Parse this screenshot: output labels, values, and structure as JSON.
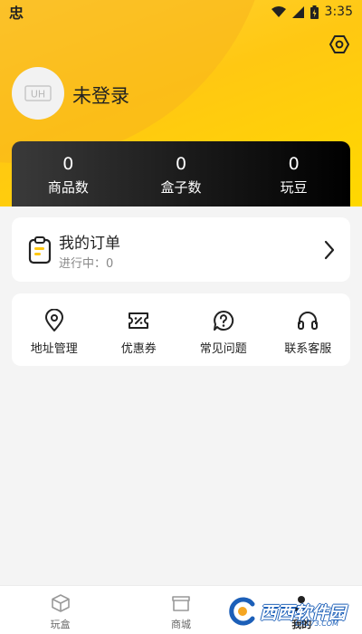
{
  "status_bar": {
    "app_glyph": "忠",
    "time": "3:35"
  },
  "profile": {
    "avatar_text": "UH",
    "name": "未登录"
  },
  "stats": [
    {
      "value": "0",
      "label": "商品数"
    },
    {
      "value": "0",
      "label": "盒子数"
    },
    {
      "value": "0",
      "label": "玩豆"
    }
  ],
  "order": {
    "title": "我的订单",
    "subtitle": "进行中：0"
  },
  "tools": [
    {
      "icon": "location-pin-icon",
      "label": "地址管理"
    },
    {
      "icon": "coupon-icon",
      "label": "优惠券"
    },
    {
      "icon": "help-icon",
      "label": "常见问题"
    },
    {
      "icon": "headset-icon",
      "label": "联系客服"
    }
  ],
  "tabs": [
    {
      "icon": "box-icon",
      "label": "玩盒"
    },
    {
      "icon": "store-icon",
      "label": "商城"
    },
    {
      "icon": "profile-icon",
      "label": "我的"
    }
  ],
  "watermark": {
    "text": "西西软件园",
    "sub": "CR173.COM"
  },
  "colors": {
    "accent": "#ffc812",
    "stats_bg": "#161616",
    "page_bg": "#f4f4f4"
  }
}
